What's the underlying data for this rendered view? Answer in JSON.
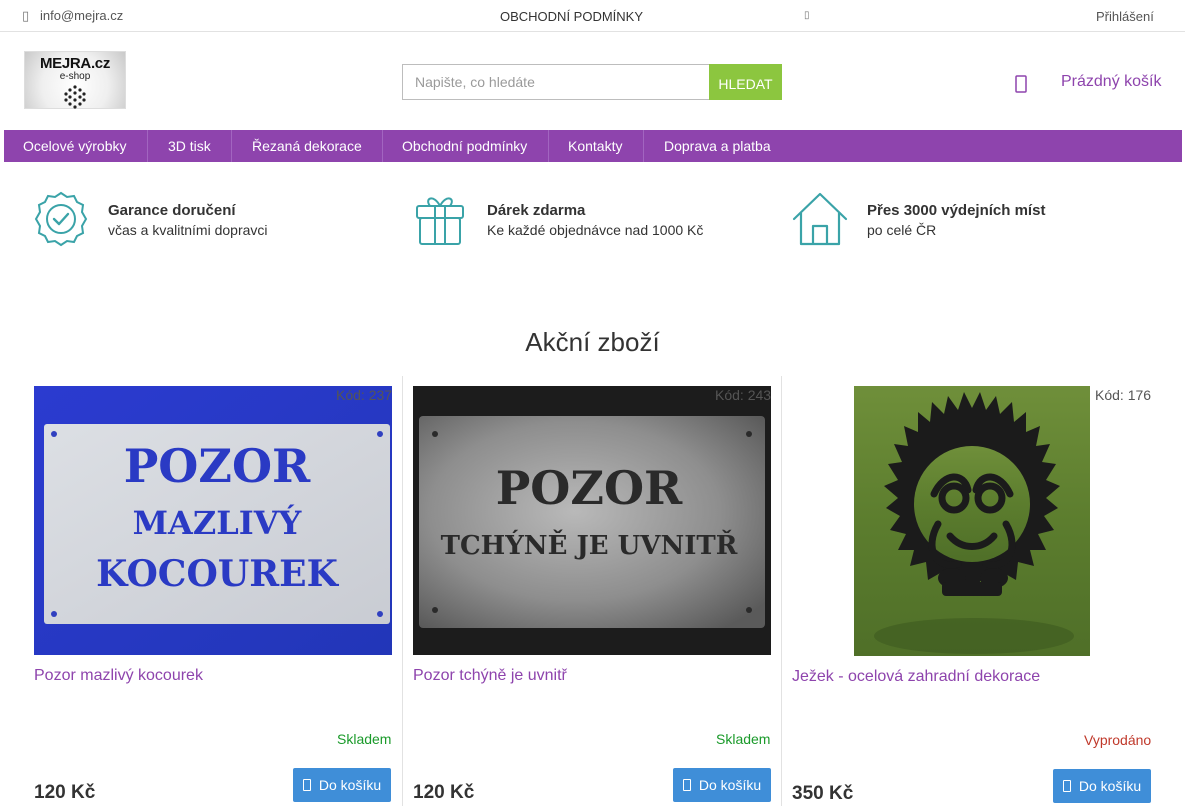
{
  "topbar": {
    "phone_icon": "phone-icon",
    "email": "info@mejra.cz",
    "terms_label": "OBCHODNÍ PODMÍNKY",
    "login_label": "Přihlášení"
  },
  "header": {
    "logo_line1": "MEJRA.cz",
    "logo_line2": "e-shop",
    "search_placeholder": "Napište, co hledáte",
    "search_button": "HLEDAT",
    "cart_label": "Prázdný košík",
    "accent_color": "#8e44ad",
    "search_button_color": "#8cc63f"
  },
  "nav": {
    "items": [
      {
        "label": "Ocelové výrobky"
      },
      {
        "label": "3D tisk"
      },
      {
        "label": "Řezaná dekorace"
      },
      {
        "label": "Obchodní podmínky"
      },
      {
        "label": "Kontakty"
      },
      {
        "label": "Doprava a platba"
      }
    ]
  },
  "benefits": [
    {
      "icon": "badge-check-icon",
      "title": "Garance doručení",
      "subtitle": "včas a kvalitními dopravci"
    },
    {
      "icon": "gift-icon",
      "title": "Dárek zdarma",
      "subtitle": "Ke každé objednávce nad 1000 Kč"
    },
    {
      "icon": "house-icon",
      "title": "Přes 3000 výdejních míst",
      "subtitle": "po celé ČR"
    }
  ],
  "section_title": "Akční zboží",
  "products": [
    {
      "code": "Kód: 237",
      "name": "Pozor mazlivý kocourek",
      "stock": "Skladem",
      "stock_color": "#1a9a2a",
      "price": "120 Kč",
      "add_label": "Do košíku",
      "sign_lines": [
        "POZOR",
        "MAZLIVÝ",
        "KOCOUREK"
      ]
    },
    {
      "code": "Kód: 243",
      "name": "Pozor tchýně je uvnitř",
      "stock": "Skladem",
      "stock_color": "#1a9a2a",
      "price": "120 Kč",
      "add_label": "Do košíku",
      "sign_lines": [
        "POZOR",
        "TCHÝNĚ JE UVNITŘ"
      ]
    },
    {
      "code": "Kód: 176",
      "name": "Ježek - ocelová zahradní dekorace",
      "stock": "Vyprodáno",
      "stock_color": "#c0392b",
      "price": "350 Kč",
      "add_label": "Do košíku"
    }
  ]
}
